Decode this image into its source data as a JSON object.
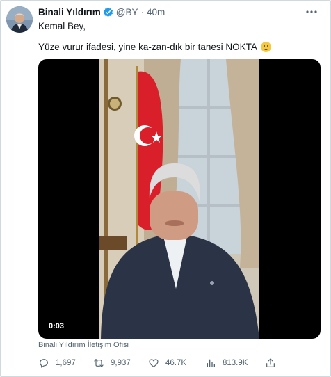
{
  "tweet": {
    "author_name": "Binali Yıldırım",
    "handle": "@BY",
    "separator": "·",
    "time": "40m",
    "more_icon": "more-dots-icon",
    "line1": "Kemal Bey,",
    "line2": "Yüze vurur ifadesi, yine ka-zan-dık bir tanesi NOKTA",
    "emoji": "slightly-smiling-face",
    "video_duration": "0:03",
    "source_label": "Binali Yıldırım İletişim Ofisi",
    "stats": {
      "replies": "1,697",
      "retweets": "9,937",
      "likes": "46.7K",
      "views": "813.9K"
    }
  },
  "colors": {
    "verified": "#1d9bf0",
    "secondary_text": "#536471",
    "flag_red": "#d91f2a"
  }
}
